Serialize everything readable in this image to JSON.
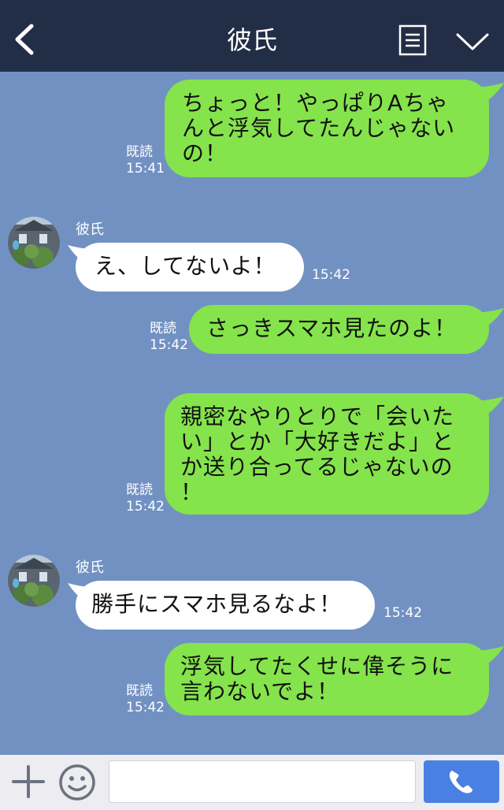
{
  "header": {
    "title": "彼氏",
    "icons": [
      "back-icon",
      "menu-icon",
      "chevron-down-icon"
    ]
  },
  "messages": [
    {
      "dir": "out",
      "text": "ちょっと！やっぱりAちゃ\nんと浮気してたんじゃない\nの！",
      "read": "既読",
      "time": "15:41"
    },
    {
      "dir": "in",
      "sender": "彼氏",
      "text": "え、してないよ！",
      "time": "15:42"
    },
    {
      "dir": "out",
      "text": "さっきスマホ見たのよ！",
      "read": "既読",
      "time": "15:42"
    },
    {
      "dir": "out",
      "text": "親密なやりとりで「会いた\nい」とか「大好きだよ」と\nか送り合ってるじゃないの\n！",
      "read": "既読",
      "time": "15:42"
    },
    {
      "dir": "in",
      "sender": "彼氏",
      "text": "勝手にスマホ見るなよ！",
      "time": "15:42"
    },
    {
      "dir": "out",
      "text": "浮気してたくせに偉そうに\n言わないでよ！",
      "read": "既読",
      "time": "15:42"
    }
  ],
  "footer": {
    "input_placeholder": "",
    "icons": [
      "plus-icon",
      "emoji-icon",
      "phone-icon"
    ]
  },
  "colors": {
    "header_bg": "#222d46",
    "chat_bg": "#7291c3",
    "outgoing_bubble": "#85e34c",
    "incoming_bubble": "#ffffff",
    "call_button": "#4a80e2"
  }
}
